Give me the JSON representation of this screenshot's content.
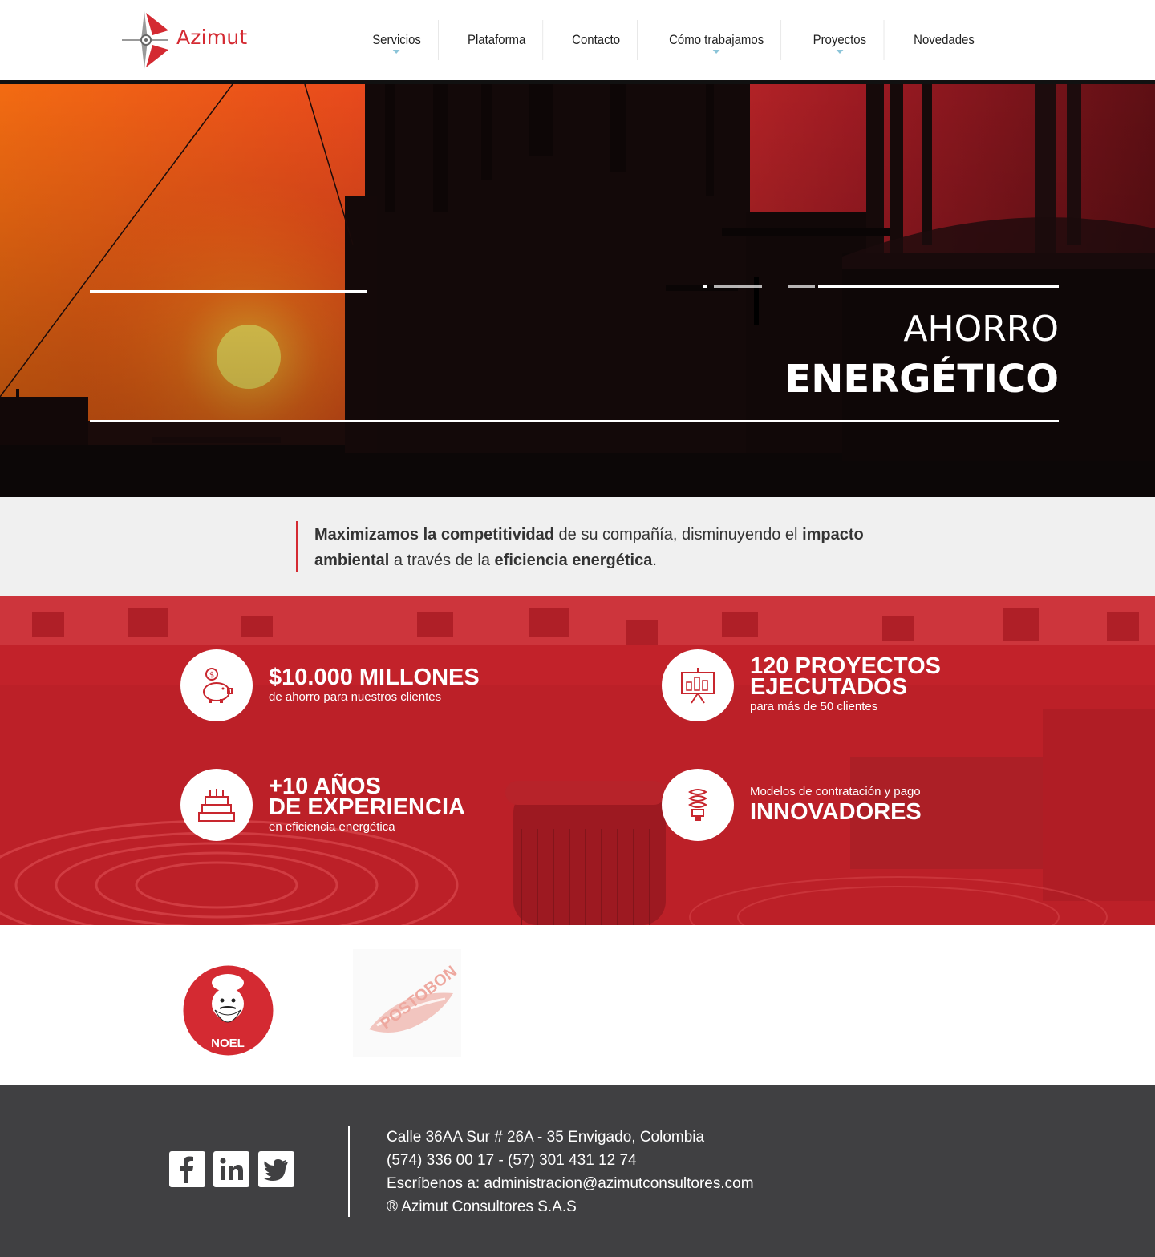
{
  "header": {
    "logo_text": "Azimut",
    "nav": [
      {
        "label": "Servicios",
        "has_dropdown": true
      },
      {
        "label": "Plataforma",
        "has_dropdown": false
      },
      {
        "label": "Contacto",
        "has_dropdown": false
      },
      {
        "label": "Cómo trabajamos",
        "has_dropdown": true
      },
      {
        "label": "Proyectos",
        "has_dropdown": true
      },
      {
        "label": "Novedades",
        "has_dropdown": false
      }
    ]
  },
  "hero": {
    "title_line1": "AHORRO",
    "title_line2": "ENERGÉTICO"
  },
  "intro": {
    "part1_bold": "Maximizamos la competitividad",
    "part2": " de su compañía, disminuyendo el ",
    "part3_bold": "impacto ambiental",
    "part4": " a través de la ",
    "part5_bold": "eficiencia energética",
    "part6": "."
  },
  "stats": [
    {
      "icon": "piggy-bank-icon",
      "big": "$10.000 MILLONES",
      "small": "de ahorro para nuestros clientes"
    },
    {
      "icon": "presentation-board-icon",
      "big_line1": "120 PROYECTOS",
      "big_line2": "EJECUTADOS",
      "small": "para más de 50 clientes"
    },
    {
      "icon": "birthday-cake-icon",
      "big_line1": "+10 AÑOS",
      "big_line2": "DE EXPERIENCIA",
      "small": "en eficiencia energética"
    },
    {
      "icon": "light-bulb-icon",
      "small": "Modelos de contratación y pago",
      "big": "INNOVADORES"
    }
  ],
  "clients": {
    "noel_label": "NOEL",
    "postobon_label": "POSTOBON"
  },
  "footer": {
    "address": "Calle 36AA Sur # 26A - 35 Envigado, Colombia",
    "phones": "(574) 336 00 17 - (57) 301 431 12 74",
    "email_line": "Escríbenos a: administracion@azimutconsultores.com",
    "copyright": "® Azimut Consultores S.A.S",
    "social": [
      "facebook-icon",
      "linkedin-icon",
      "twitter-icon"
    ]
  },
  "colors": {
    "brand_red": "#d42a32",
    "footer_bg": "#404042",
    "intro_bg": "#f0f0f0",
    "caret": "#8bc4d8"
  }
}
